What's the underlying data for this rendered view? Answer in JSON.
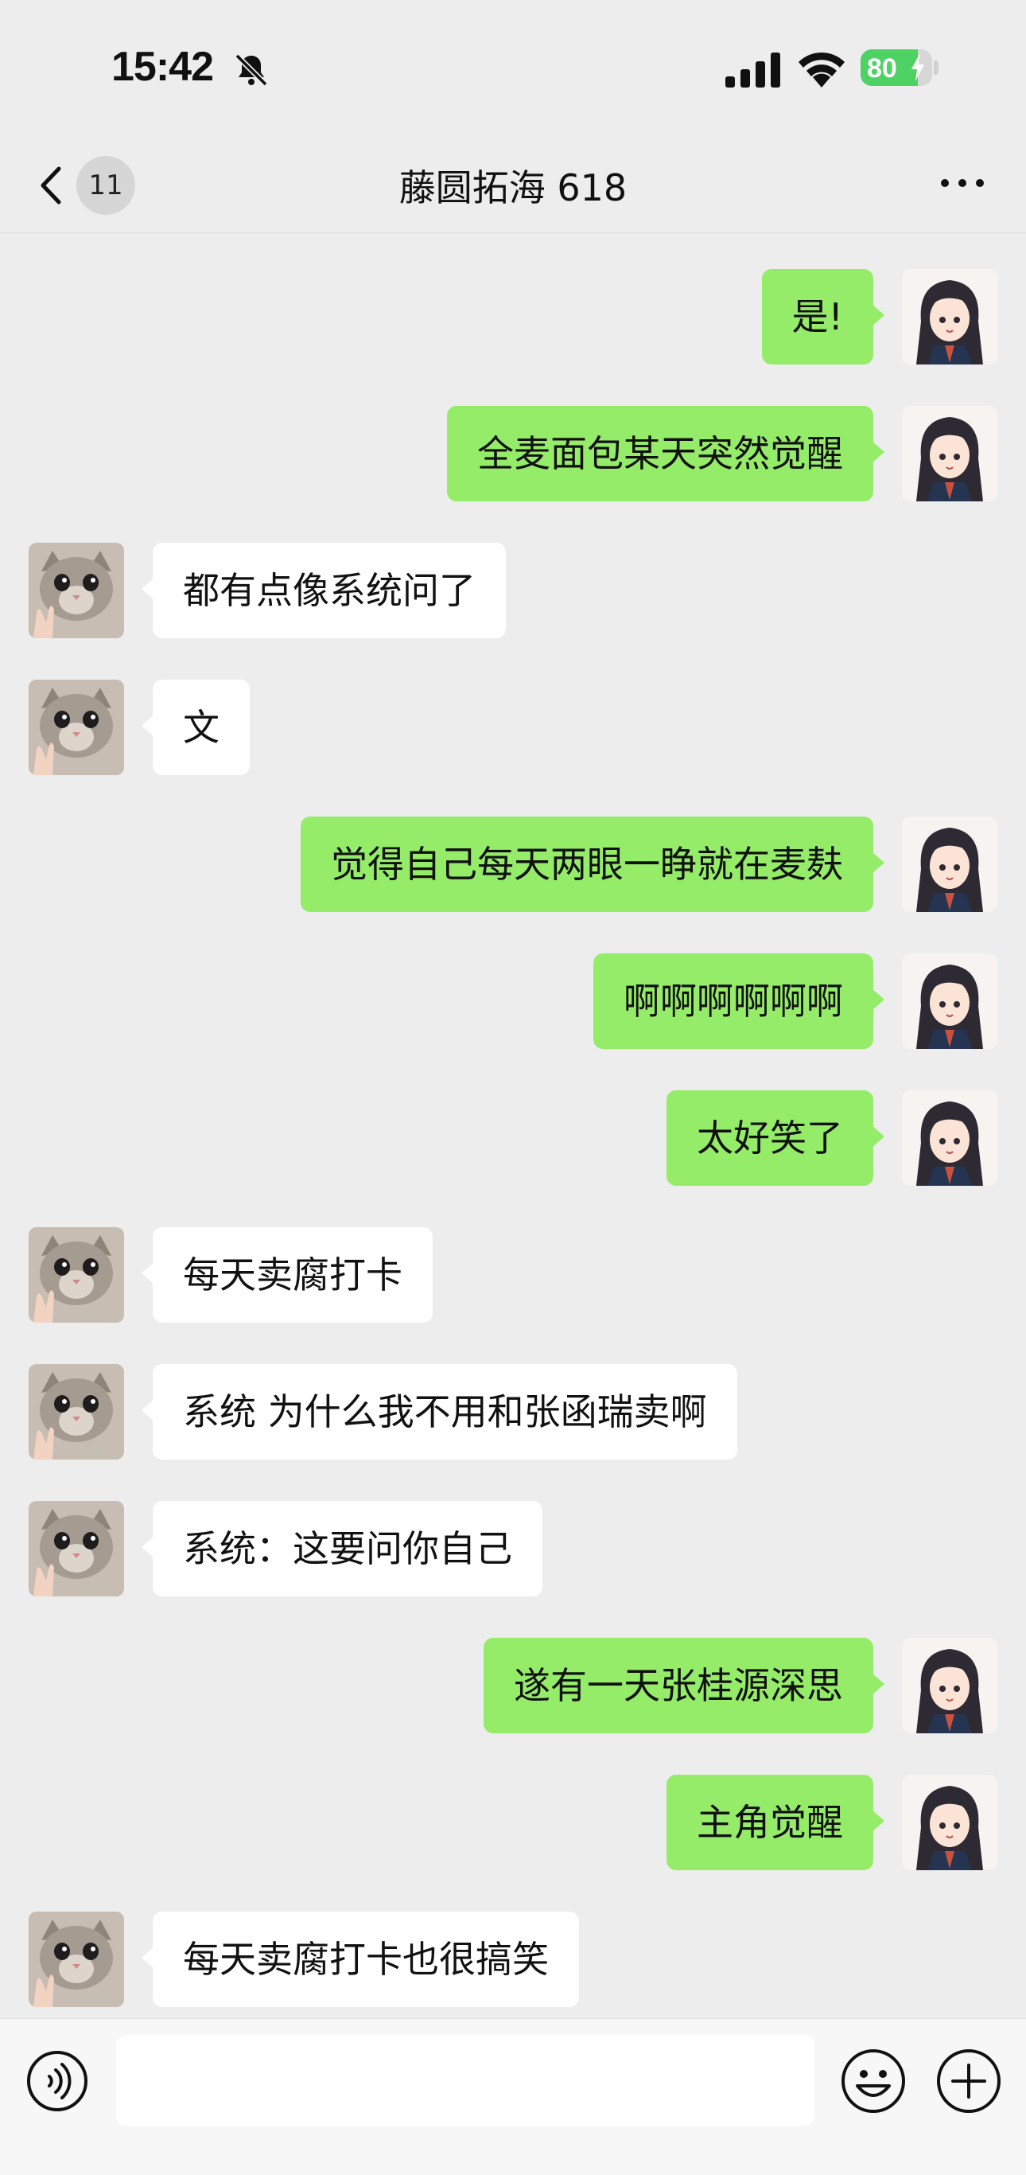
{
  "status_bar": {
    "time": "15:42",
    "battery_level": 80,
    "battery_label": "80",
    "icons": [
      "bell-slash-icon",
      "signal-icon",
      "wifi-icon",
      "battery-charging-icon"
    ]
  },
  "nav": {
    "back_badge": "11",
    "title": "藤圆拓海 618",
    "icons": [
      "chevron-left-icon",
      "more-icon"
    ]
  },
  "colors": {
    "background": "#ededed",
    "self_bubble": "#95ec69",
    "other_bubble": "#ffffff",
    "battery_green": "#4fd264"
  },
  "messages": [
    {
      "sender": "self",
      "text": "是!"
    },
    {
      "sender": "self",
      "text": "全麦面包某天突然觉醒"
    },
    {
      "sender": "other",
      "text": "都有点像系统问了"
    },
    {
      "sender": "other",
      "text": "文"
    },
    {
      "sender": "self",
      "text": "觉得自己每天两眼一睁就在麦麸"
    },
    {
      "sender": "self",
      "text": "啊啊啊啊啊啊"
    },
    {
      "sender": "self",
      "text": "太好笑了"
    },
    {
      "sender": "other",
      "text": "每天卖腐打卡"
    },
    {
      "sender": "other",
      "text": "系统 为什么我不用和张函瑞卖啊"
    },
    {
      "sender": "other",
      "text": "系统：这要问你自己"
    },
    {
      "sender": "self",
      "text": "遂有一天张桂源深思"
    },
    {
      "sender": "self",
      "text": "主角觉醒"
    },
    {
      "sender": "other",
      "text": "每天卖腐打卡也很搞笑"
    }
  ],
  "input_bar": {
    "value": "",
    "icons": [
      "voice-icon",
      "emoji-icon",
      "plus-icon"
    ]
  }
}
